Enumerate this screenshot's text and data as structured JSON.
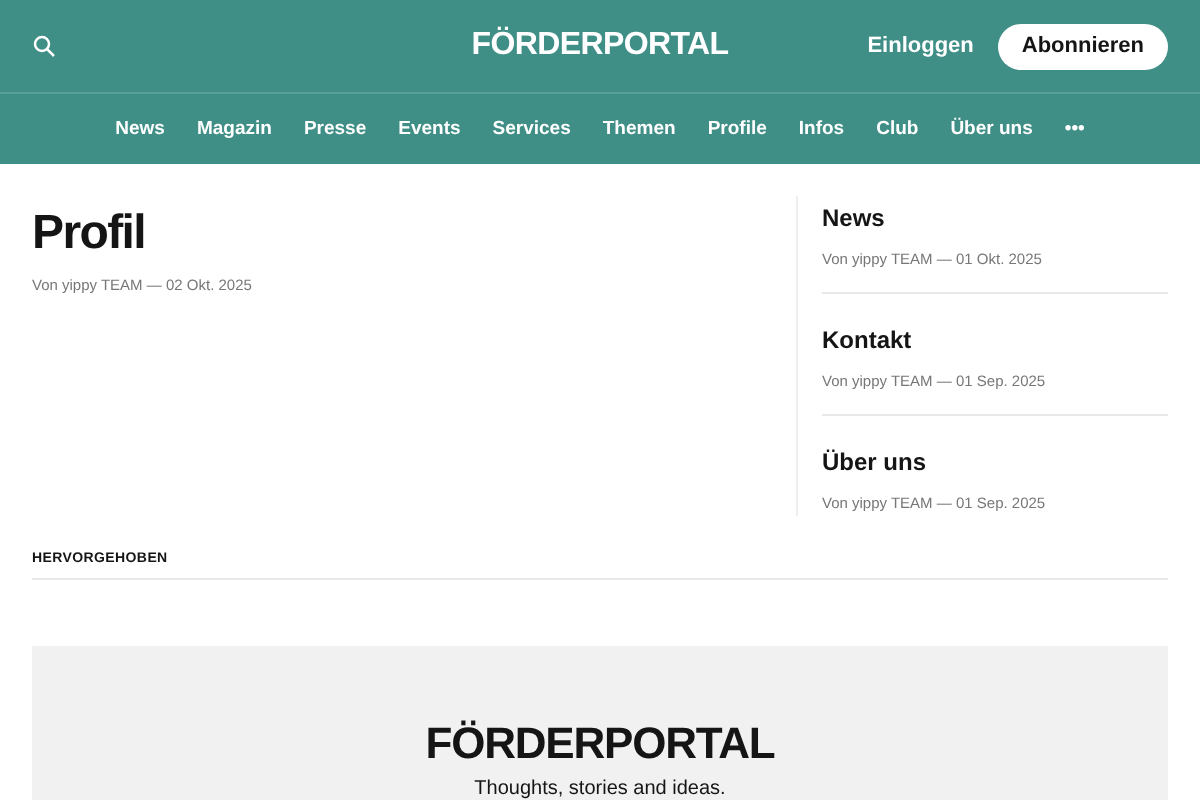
{
  "header": {
    "title": "FÖRDERPORTAL",
    "login": "Einloggen",
    "subscribe": "Abonnieren"
  },
  "nav": [
    "News",
    "Magazin",
    "Presse",
    "Events",
    "Services",
    "Themen",
    "Profile",
    "Infos",
    "Club",
    "Über uns",
    "•••"
  ],
  "article": {
    "title": "Profil",
    "meta": "Von yippy TEAM — 02 Okt. 2025"
  },
  "sidebar": [
    {
      "title": "News",
      "meta": "Von yippy TEAM — 01 Okt. 2025"
    },
    {
      "title": "Kontakt",
      "meta": "Von yippy TEAM — 01 Sep. 2025"
    },
    {
      "title": "Über uns",
      "meta": "Von yippy TEAM — 01 Sep. 2025"
    }
  ],
  "featured": {
    "heading": "HERVORGEHOBEN"
  },
  "banner": {
    "title": "FÖRDERPORTAL",
    "tagline": "Thoughts, stories and ideas."
  }
}
